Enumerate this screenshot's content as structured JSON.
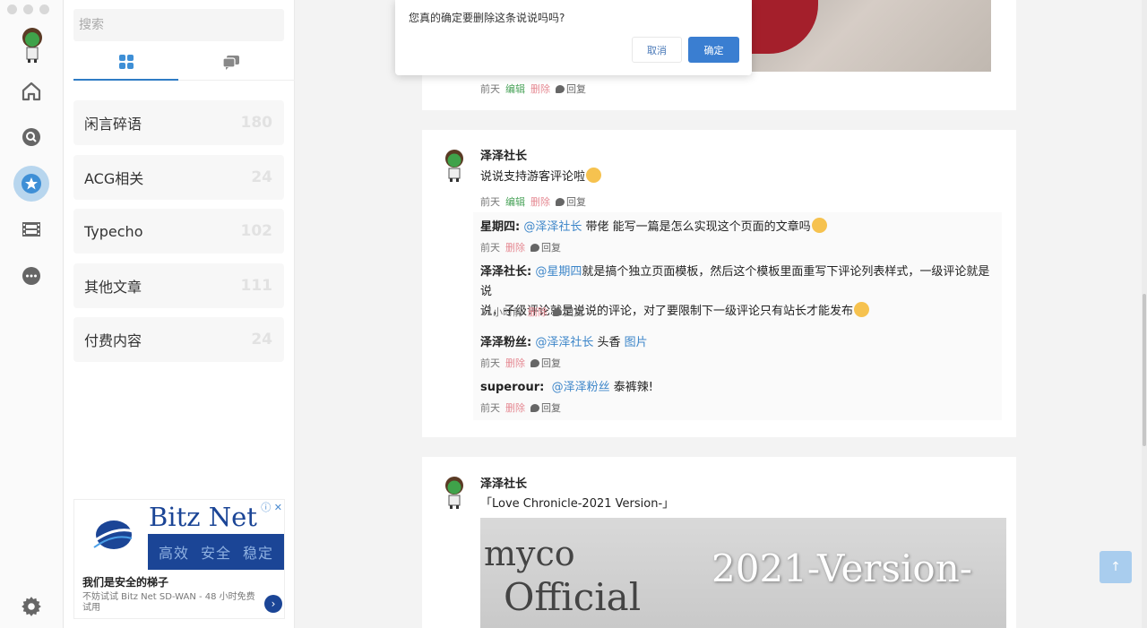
{
  "search": {
    "placeholder": "搜索"
  },
  "categories": [
    {
      "name": "闲言碎语",
      "count": "180"
    },
    {
      "name": "ACG相关",
      "count": "24"
    },
    {
      "name": "Typecho",
      "count": "102"
    },
    {
      "name": "其他文章",
      "count": "111"
    },
    {
      "name": "付费内容",
      "count": "24"
    }
  ],
  "ad": {
    "brand": "Bitz Net",
    "tagline": [
      "高效",
      "安全",
      "稳定"
    ],
    "title": "我们是安全的梯子",
    "desc": "不妨试试 Bitz Net SD-WAN - 48 小时免费试用"
  },
  "dialog": {
    "message": "您真的确定要删除这条说说吗吗?",
    "cancel": "取消",
    "confirm": "确定"
  },
  "actions": {
    "edit": "编辑",
    "delete": "删除",
    "reply": "回复"
  },
  "post1": {
    "time": "前天"
  },
  "post2": {
    "author": "泽泽社长",
    "content": "说说支持游客评论啦",
    "time": "前天",
    "comments": [
      {
        "author": "星期四:",
        "mention": "@泽泽社长",
        "text": "带佬 能写一篇是怎么实现这个页面的文章吗",
        "time": "前天"
      },
      {
        "author": "泽泽社长:",
        "mention": "@星期四",
        "text": "就是搞个独立页面模板，然后这个模板里面重写下评论列表样式，一级评论就是说",
        "text2": "说，子级评论就是说说的评论，对了要限制下一级评论只有站长才能发布",
        "time": "21小时前"
      },
      {
        "author": "泽泽粉丝:",
        "mention": "@泽泽社长",
        "text": "头香",
        "link": "图片",
        "time": "前天"
      },
      {
        "author": "superour:",
        "mention": "@泽泽粉丝",
        "text": "泰裤辣!",
        "time": "前天"
      }
    ]
  },
  "post3": {
    "author": "泽泽社长",
    "content": "「Love Chronicle-2021 Version-」",
    "video": {
      "line1": "myco",
      "line2": "Official",
      "line3": "2021-Version-"
    }
  }
}
